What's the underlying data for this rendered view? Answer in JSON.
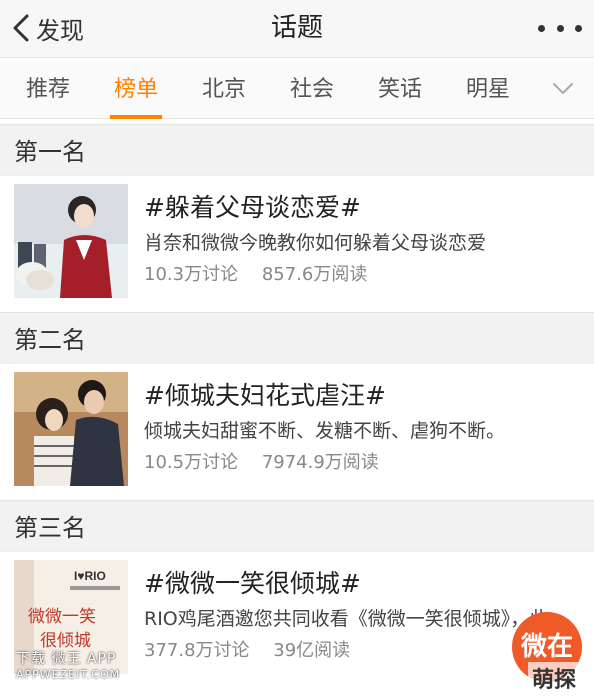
{
  "nav": {
    "back_label": "发现",
    "title": "话题"
  },
  "tabs": [
    {
      "label": "推荐",
      "active": false
    },
    {
      "label": "榜单",
      "active": true
    },
    {
      "label": "北京",
      "active": false
    },
    {
      "label": "社会",
      "active": false
    },
    {
      "label": "笑话",
      "active": false
    },
    {
      "label": "明星",
      "active": false
    }
  ],
  "sections": [
    {
      "heading": "第一名",
      "topic": {
        "title": "#躲着父母谈恋爱#",
        "desc": "肖奈和微微今晚教你如何躲着父母谈恋爱",
        "discussions": "10.3万讨论",
        "reads": "857.6万阅读"
      }
    },
    {
      "heading": "第二名",
      "topic": {
        "title": "#倾城夫妇花式虐汪#",
        "desc": "倾城夫妇甜蜜不断、发糖不断、虐狗不断。",
        "discussions": "10.5万讨论",
        "reads": "7974.9万阅读"
      }
    },
    {
      "heading": "第三名",
      "topic": {
        "title": "#微微一笑很倾城#",
        "desc": "RIO鸡尾酒邀您共同收看《微微一笑很倾城》，此...",
        "discussions": "377.8万讨论",
        "reads": "39亿阅读"
      }
    }
  ],
  "thumb3": {
    "brand": "I♥RIO",
    "caption": "微微一笑很倾城"
  },
  "overlay": {
    "watermark": "下载 微王 APP",
    "watermark_url": "APPWEZEIT.COM",
    "fab_label": "微在",
    "corner_mark": "萌探说"
  },
  "colors": {
    "accent": "#ff8200",
    "fab": "#f05a28"
  },
  "icons": {
    "back": "chevron-left-icon",
    "more": "more-dots-icon",
    "tab_expand": "chevron-down-icon"
  }
}
